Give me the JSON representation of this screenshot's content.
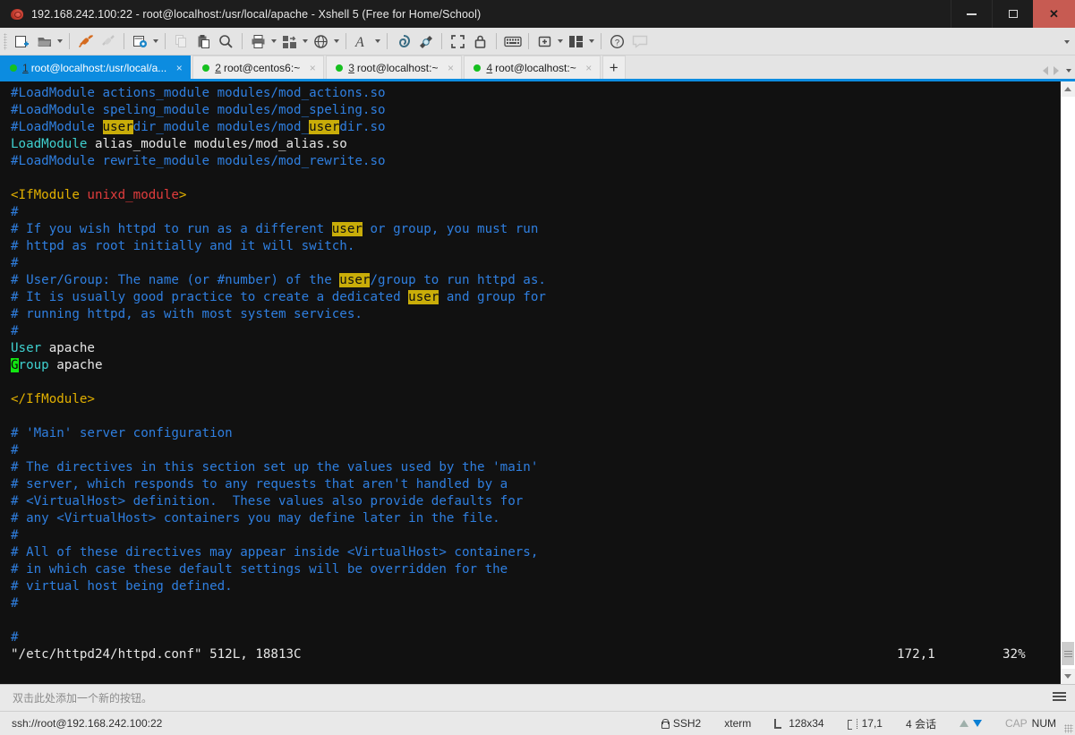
{
  "window": {
    "title": "192.168.242.100:22 - root@localhost:/usr/local/apache - Xshell 5 (Free for Home/School)",
    "app_icon": "xshell-shell-icon",
    "minimize_label": "–",
    "maximize_label": "□",
    "close_label": "✕"
  },
  "toolbar": {
    "items": [
      {
        "name": "new-session-icon",
        "label": ""
      },
      {
        "name": "open-session-icon",
        "label": ""
      },
      {
        "name": "connect-icon",
        "label": ""
      },
      {
        "name": "disconnect-icon",
        "label": ""
      },
      {
        "name": "session-properties-icon",
        "label": ""
      },
      {
        "name": "copy-icon",
        "label": ""
      },
      {
        "name": "paste-icon",
        "label": ""
      },
      {
        "name": "find-icon",
        "label": ""
      },
      {
        "name": "print-icon",
        "label": ""
      },
      {
        "name": "file-transfer-icon",
        "label": ""
      },
      {
        "name": "web-transfer-icon",
        "label": ""
      },
      {
        "name": "font-icon",
        "label": ""
      },
      {
        "name": "log-session-icon",
        "label": ""
      },
      {
        "name": "screen-capture-icon",
        "label": ""
      },
      {
        "name": "full-screen-icon",
        "label": ""
      },
      {
        "name": "lock-icon",
        "label": ""
      },
      {
        "name": "compose-bar-icon",
        "label": ""
      },
      {
        "name": "add-panel-icon",
        "label": ""
      },
      {
        "name": "arrange-layout-icon",
        "label": ""
      },
      {
        "name": "help-icon",
        "label": ""
      },
      {
        "name": "chat-icon",
        "label": ""
      }
    ],
    "overflow_label": ""
  },
  "tabs": {
    "items": [
      {
        "num": "1",
        "label": "root@localhost:/usr/local/a...",
        "active": true,
        "status": "connected"
      },
      {
        "num": "2",
        "label": "root@centos6:~",
        "active": false,
        "status": "connected"
      },
      {
        "num": "3",
        "label": "root@localhost:~",
        "active": false,
        "status": "connected"
      },
      {
        "num": "4",
        "label": "root@localhost:~",
        "active": false,
        "status": "connected"
      }
    ],
    "close_label": "×",
    "new_tab_label": "+"
  },
  "terminal": {
    "lines": [
      [
        {
          "t": "#LoadModule actions_module modules/mod_actions.so",
          "c": "c-comment"
        }
      ],
      [
        {
          "t": "#LoadModule speling_module modules/mod_speling.so",
          "c": "c-comment"
        }
      ],
      [
        {
          "t": "#LoadModule ",
          "c": "c-comment"
        },
        {
          "t": "user",
          "c": "hl"
        },
        {
          "t": "dir_module modules/mod_",
          "c": "c-comment"
        },
        {
          "t": "user",
          "c": "hl"
        },
        {
          "t": "dir.so",
          "c": "c-comment"
        }
      ],
      [
        {
          "t": "LoadModule",
          "c": "c-kw"
        },
        {
          "t": " alias_module modules/mod_alias.so",
          "c": "c-plain"
        }
      ],
      [
        {
          "t": "#LoadModule rewrite_module modules/mod_rewrite.so",
          "c": "c-comment"
        }
      ],
      [],
      [
        {
          "t": "<IfModule ",
          "c": "c-tag"
        },
        {
          "t": "unixd_module",
          "c": "c-mod"
        },
        {
          "t": ">",
          "c": "c-tag"
        }
      ],
      [
        {
          "t": "#",
          "c": "c-comment"
        }
      ],
      [
        {
          "t": "# If you wish httpd to run as a different ",
          "c": "c-comment"
        },
        {
          "t": "user",
          "c": "hl"
        },
        {
          "t": " or group, you must run",
          "c": "c-comment"
        }
      ],
      [
        {
          "t": "# httpd as root initially and it will switch.",
          "c": "c-comment"
        }
      ],
      [
        {
          "t": "#",
          "c": "c-comment"
        }
      ],
      [
        {
          "t": "# User/Group: The name (or #number) of the ",
          "c": "c-comment"
        },
        {
          "t": "user",
          "c": "hl"
        },
        {
          "t": "/group to run httpd as.",
          "c": "c-comment"
        }
      ],
      [
        {
          "t": "# It is usually good practice to create a dedicated ",
          "c": "c-comment"
        },
        {
          "t": "user",
          "c": "hl"
        },
        {
          "t": " and group for",
          "c": "c-comment"
        }
      ],
      [
        {
          "t": "# running httpd, as with most system services.",
          "c": "c-comment"
        }
      ],
      [
        {
          "t": "#",
          "c": "c-comment"
        }
      ],
      [
        {
          "t": "User",
          "c": "c-kw"
        },
        {
          "t": " apache",
          "c": "c-plain"
        }
      ],
      [
        {
          "t": "G",
          "c": "cursor"
        },
        {
          "t": "roup",
          "c": "c-kw"
        },
        {
          "t": " apache",
          "c": "c-plain"
        }
      ],
      [],
      [
        {
          "t": "</IfModule>",
          "c": "c-tag"
        }
      ],
      [],
      [
        {
          "t": "# 'Main' server configuration",
          "c": "c-comment"
        }
      ],
      [
        {
          "t": "#",
          "c": "c-comment"
        }
      ],
      [
        {
          "t": "# The directives in this section set up the values used by the 'main'",
          "c": "c-comment"
        }
      ],
      [
        {
          "t": "# server, which responds to any requests that aren't handled by a",
          "c": "c-comment"
        }
      ],
      [
        {
          "t": "# <VirtualHost> definition.  These values also provide defaults for",
          "c": "c-comment"
        }
      ],
      [
        {
          "t": "# any <VirtualHost> containers you may define later in the file.",
          "c": "c-comment"
        }
      ],
      [
        {
          "t": "#",
          "c": "c-comment"
        }
      ],
      [
        {
          "t": "# All of these directives may appear inside <VirtualHost> containers,",
          "c": "c-comment"
        }
      ],
      [
        {
          "t": "# in which case these default settings will be overridden for the",
          "c": "c-comment"
        }
      ],
      [
        {
          "t": "# virtual host being defined.",
          "c": "c-comment"
        }
      ],
      [
        {
          "t": "#",
          "c": "c-comment"
        }
      ],
      [],
      [
        {
          "t": "#",
          "c": "c-comment"
        }
      ]
    ],
    "status_line": {
      "file_info": "\"/etc/httpd24/httpd.conf\" 512L, 18813C",
      "position": "172,1",
      "percent": "32%"
    }
  },
  "quickbar": {
    "hint": "双击此处添加一个新的按钮。",
    "menu_icon": "hamburger-icon"
  },
  "statusbar": {
    "connection": "ssh://root@192.168.242.100:22",
    "protocol": "SSH2",
    "terminal_type": "xterm",
    "size": "128x34",
    "cursor_position": "17,1",
    "sessions": "4 会话",
    "caps": "CAP",
    "numlock": "NUM"
  },
  "colors": {
    "accent": "#0c8ce0",
    "close_button": "#c75b52",
    "terminal_bg": "#111111",
    "comment": "#2f7fe0",
    "keyword": "#3fd0cf",
    "tag": "#e2b000",
    "module": "#e03c3c",
    "highlight_bg": "#c9ad09",
    "cursor_bg": "#12e612",
    "tab_dot": "#16c020"
  }
}
